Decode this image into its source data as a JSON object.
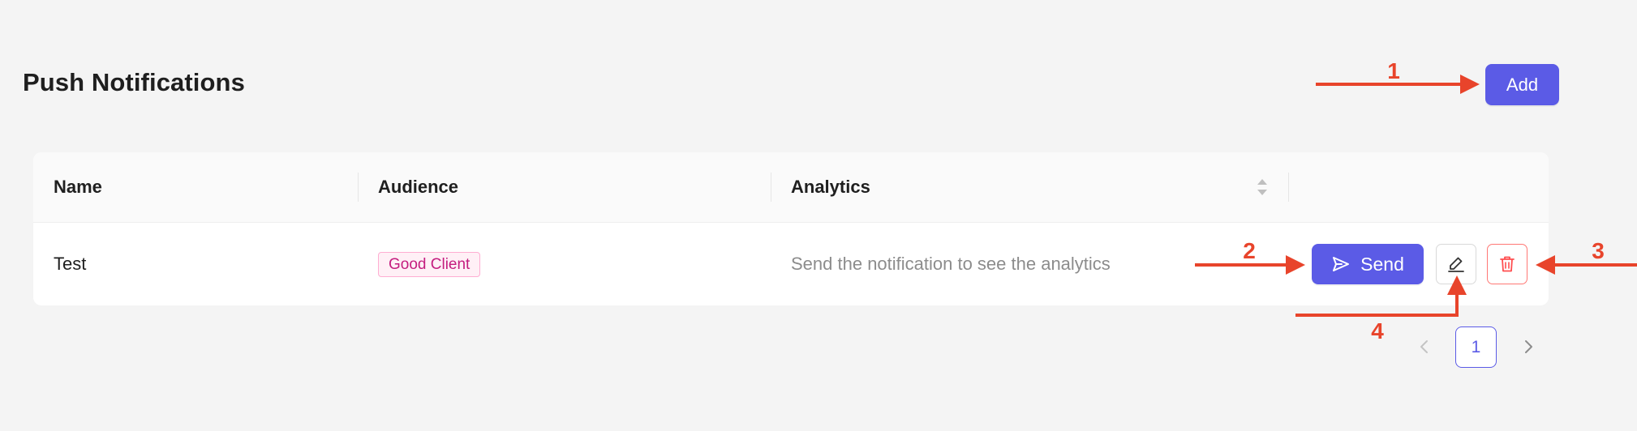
{
  "page": {
    "title": "Push Notifications",
    "add_label": "Add"
  },
  "table": {
    "columns": [
      "Name",
      "Audience",
      "Analytics",
      ""
    ],
    "rows": [
      {
        "name": "Test",
        "audience_tag": "Good Client",
        "analytics": "Send the notification to see the analytics",
        "send_label": "Send"
      }
    ]
  },
  "pagination": {
    "current_page": "1"
  },
  "annotations": {
    "labels": [
      "1",
      "2",
      "3",
      "4"
    ]
  },
  "colors": {
    "primary": "#5b5be6",
    "annotation": "#e8442b",
    "tag_text": "#c41d7f",
    "tag_bg": "#fff0f6",
    "tag_border": "#ffadd2",
    "danger": "#ff4d4f"
  },
  "icons": {
    "send": "send-icon",
    "edit": "edit-icon",
    "delete": "trash-icon",
    "sort": "sort-icon",
    "prev": "chevron-left-icon",
    "next": "chevron-right-icon"
  }
}
